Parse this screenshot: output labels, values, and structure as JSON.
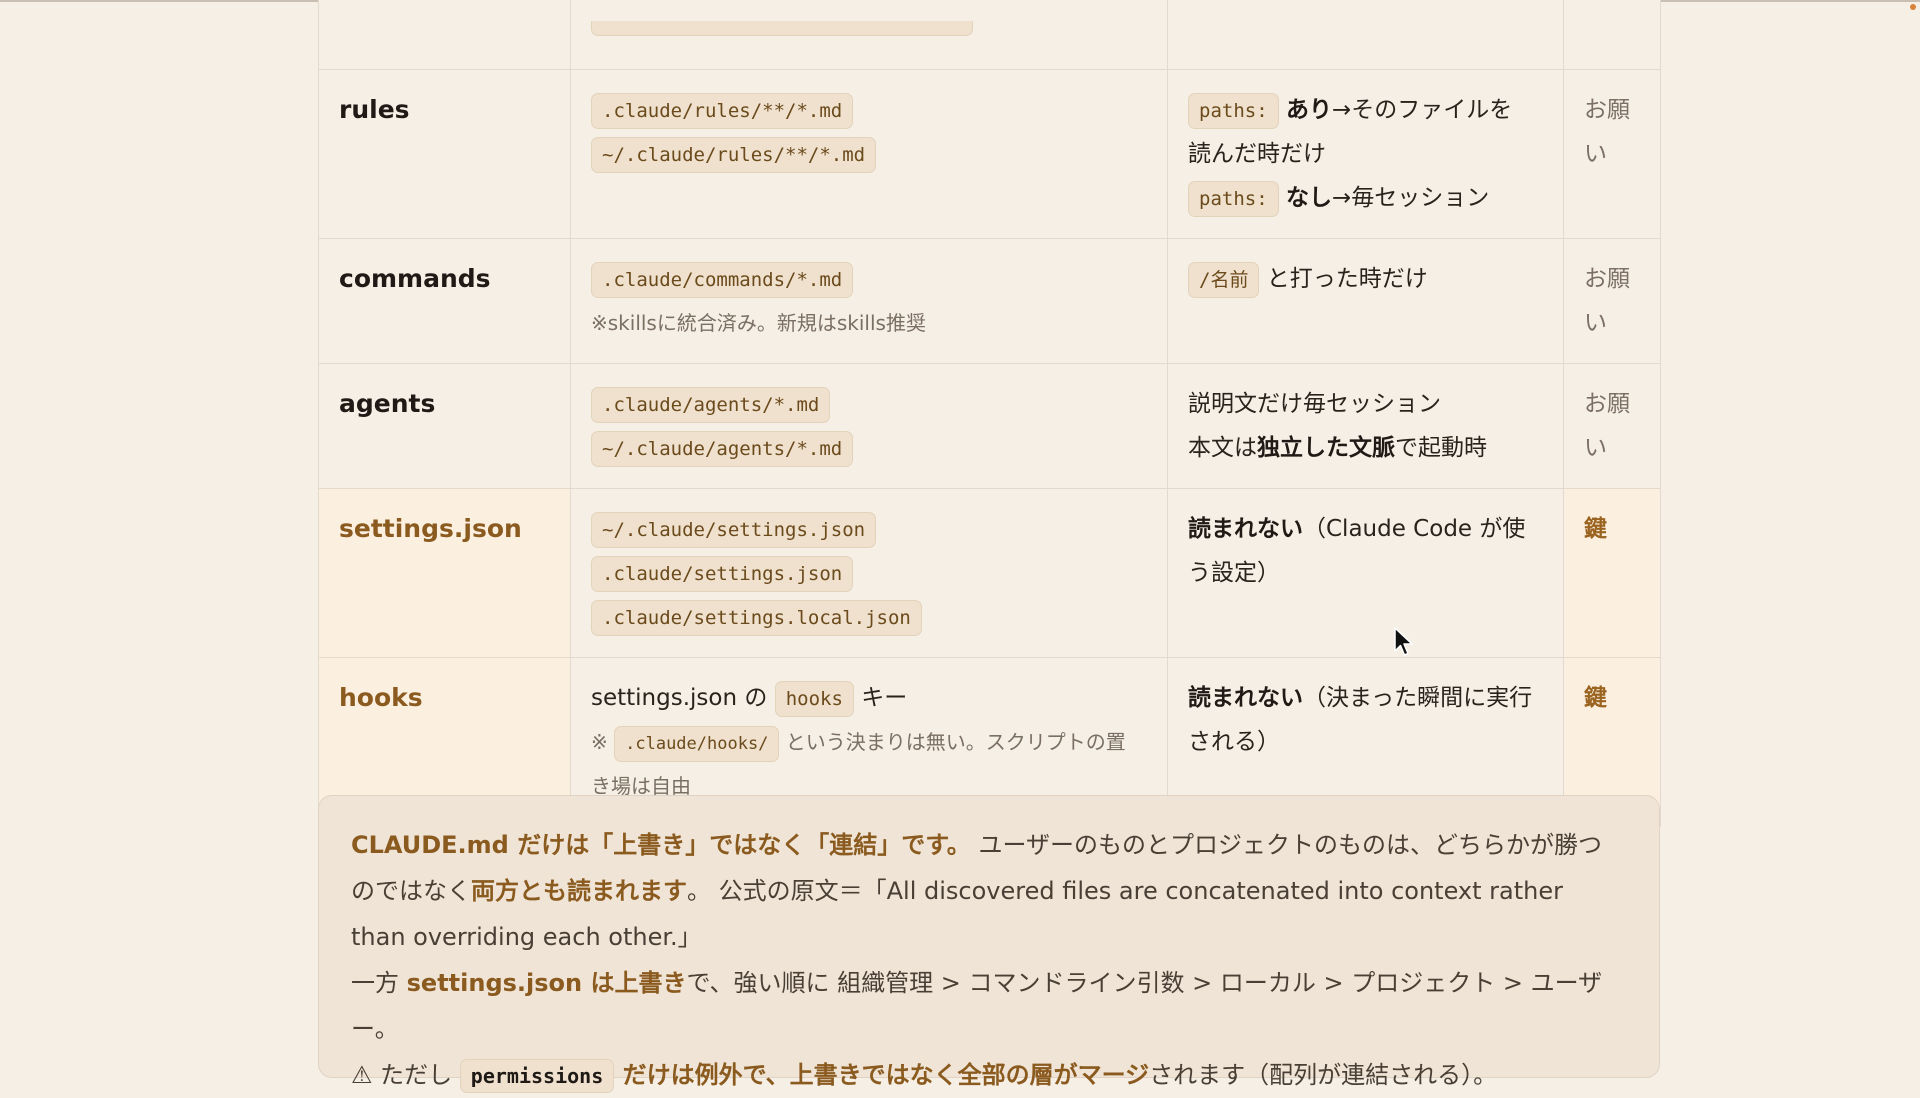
{
  "table": {
    "rows": [
      {
        "name": "rules",
        "paths": [
          ".claude/rules/**/*.md",
          "~/.claude/rules/**/*.md"
        ],
        "when": {
          "code1": "paths:",
          "text1_bold": "あり",
          "text1": "→そのファイルを",
          "text1_cont": "読んだ時だけ",
          "code2": "paths:",
          "text2_bold": "なし",
          "text2": "→毎セッション"
        },
        "type_line1": "お願",
        "type_line2": "い"
      },
      {
        "name": "commands",
        "paths": [
          ".claude/commands/*.md"
        ],
        "note": "※skillsに統合済み。新規はskills推奨",
        "when": {
          "code1": "/名前",
          "text1": " と打った時だけ"
        },
        "type_line1": "お願",
        "type_line2": "い"
      },
      {
        "name": "agents",
        "paths": [
          ".claude/agents/*.md",
          "~/.claude/agents/*.md"
        ],
        "when": {
          "line1": "説明文だけ毎セッション",
          "line2_pre": "本文は",
          "line2_bold": "独立した文脈",
          "line2_post": "で起動時"
        },
        "type_line1": "お願",
        "type_line2": "い"
      },
      {
        "name": "settings.json",
        "paths": [
          "~/.claude/settings.json",
          ".claude/settings.json",
          ".claude/settings.local.json"
        ],
        "when": {
          "bold": "読まれない",
          "line1": "（Claude Code が使",
          "line2": "う設定）"
        },
        "type_line1": "鍵"
      },
      {
        "name": "hooks",
        "where": {
          "pre": "settings.json の ",
          "code": "hooks",
          "post": " キー"
        },
        "note": {
          "pre": "※ ",
          "code": ".claude/hooks/",
          "post": " という決まりは無い。スクリプトの置",
          "line2": "き場は自由"
        },
        "when": {
          "bold": "読まれない",
          "line1": "（決まった瞬間に実行",
          "line2": "される）"
        },
        "type_line1": "鍵"
      }
    ]
  },
  "callout": {
    "p1_acc": "CLAUDE.md だけは「上書き」ではなく「連結」です。",
    "p1_rest": " ユーザーのものとプロジェクトのものは、どちらかが勝つ",
    "p2_pre": "のではなく",
    "p2_acc": "両方とも読まれます",
    "p2_rest": "。 公式の原文＝「All discovered files are concatenated into context rather",
    "p3": "than overriding each other.」",
    "p4_pre": "一方 ",
    "p4_acc": "settings.json は上書き",
    "p4_rest": "で、強い順に 組織管理 > コマンドライン引数 > ローカル > プロジェクト > ユーザー。",
    "p5_warn": "⚠ ただし ",
    "p5_code": "permissions",
    "p5_acc": " だけは例外で、上書きではなく全部の層がマージ",
    "p5_rest": "されます（配列が連結される）。"
  },
  "colors": {
    "accent": "#8a5a1e",
    "background": "#f6efe6",
    "code_bg": "#efe1cd"
  },
  "icons": {
    "cursor": "mouse-pointer-icon",
    "warning": "warning-icon"
  }
}
